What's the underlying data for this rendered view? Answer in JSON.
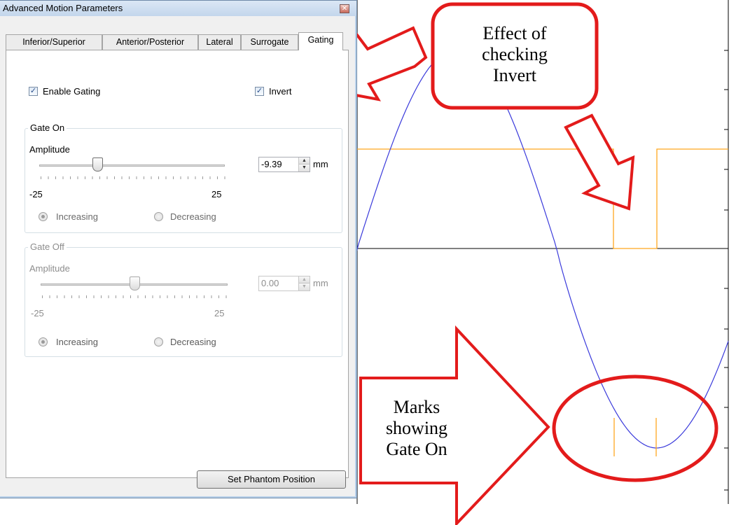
{
  "window": {
    "title": "Advanced Motion Parameters",
    "close_icon": "close-icon"
  },
  "tabs": [
    {
      "label": "Inferior/Superior",
      "active": false
    },
    {
      "label": "Anterior/Posterior",
      "active": false
    },
    {
      "label": "Lateral",
      "active": false
    },
    {
      "label": "Surrogate",
      "active": false
    },
    {
      "label": "Gating",
      "active": true
    }
  ],
  "gating": {
    "enable_label": "Enable Gating",
    "enable_checked": true,
    "invert_label": "Invert",
    "invert_checked": true
  },
  "gate_on": {
    "title": "Gate On",
    "amplitude_label": "Amplitude",
    "min_label": "-25",
    "max_label": "25",
    "slider_value": -9.39,
    "value": "-9.39",
    "unit": "mm",
    "increasing_label": "Increasing",
    "decreasing_label": "Decreasing",
    "direction": "Increasing"
  },
  "gate_off": {
    "title": "Gate Off",
    "amplitude_label": "Amplitude",
    "min_label": "-25",
    "max_label": "25",
    "slider_value": 0,
    "value": "0.00",
    "unit": "mm",
    "increasing_label": "Increasing",
    "decreasing_label": "Decreasing",
    "direction": "Increasing",
    "enabled": false
  },
  "set_phantom_button": "Set Phantom Position",
  "callouts": {
    "invert_lines": [
      "Effect of",
      "checking",
      "Invert"
    ],
    "gate_on_lines": [
      "Marks",
      "showing",
      "Gate On"
    ]
  },
  "colors": {
    "waveform": "#3a3adb",
    "gate_signal": "#ffa81f",
    "callout": "#e31b1b"
  }
}
